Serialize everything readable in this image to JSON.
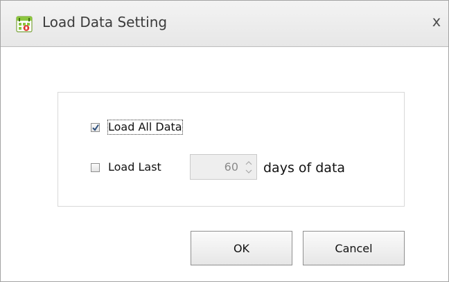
{
  "dialog": {
    "title": "Load Data Setting",
    "close_glyph": "x",
    "app_icon": "app-calendar-icon"
  },
  "options": {
    "load_all": {
      "label": "Load All Data",
      "checked": true
    },
    "load_last": {
      "label": "Load Last",
      "checked": false
    }
  },
  "days_input": {
    "value": "60",
    "enabled": false
  },
  "days_suffix": "days of data",
  "buttons": {
    "ok": "OK",
    "cancel": "Cancel"
  },
  "colors": {
    "title_bar": "#ececec",
    "check_mark": "#2d4f7c",
    "disabled_input": "#eeeeee"
  }
}
